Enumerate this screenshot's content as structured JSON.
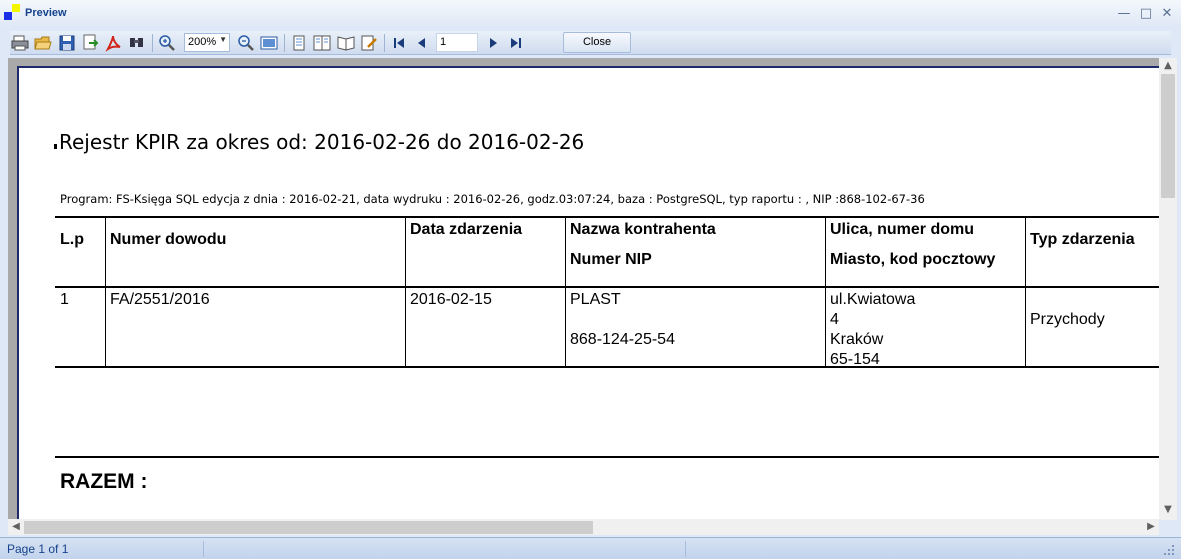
{
  "window": {
    "title": "Preview"
  },
  "toolbar": {
    "zoom": "200%",
    "page_number": "1",
    "close_label": "Close"
  },
  "report": {
    "title": "Rejestr KPIR za okres od: 2016-02-26 do 2016-02-26",
    "program_info": "Program: FS-Księga SQL edycja z dnia : 2016-02-21, data wydruku : 2016-02-26, godz.03:07:24, baza : PostgreSQL, typ raportu : , NIP :868-102-67-36",
    "headers": {
      "lp": "L.p",
      "numer_dowodu": "Numer dowodu",
      "data_zdarzenia": "Data zdarzenia",
      "nazwa_kontrahenta": "Nazwa kontrahenta",
      "numer_nip": "Numer NIP",
      "ulica": "Ulica, numer domu",
      "miasto": "Miasto, kod pocztowy",
      "typ_zdarzenia": "Typ zdarzenia"
    },
    "row": {
      "lp": "1",
      "numer_dowodu": "FA/2551/2016",
      "data_zdarzenia": "2016-02-15",
      "nazwa_kontrahenta": "PLAST",
      "numer_nip": "868-124-25-54",
      "ulica": "ul.Kwiatowa",
      "numer_domu": "4",
      "miasto": "Kraków",
      "kod_pocztowy": "65-154",
      "typ_zdarzenia": "Przychody"
    },
    "razem_label": "RAZEM :"
  },
  "status": {
    "page_info": "Page 1 of 1"
  },
  "icons": [
    "print-icon",
    "open-icon",
    "save-icon",
    "export-icon",
    "pdf-icon",
    "find-icon",
    "zoom-in-icon",
    "zoom-out-icon",
    "page-width-icon",
    "single-page-icon",
    "two-pages-icon",
    "multi-pages-icon",
    "edit-icon",
    "first-page-icon",
    "prev-page-icon",
    "next-page-icon",
    "last-page-icon"
  ]
}
